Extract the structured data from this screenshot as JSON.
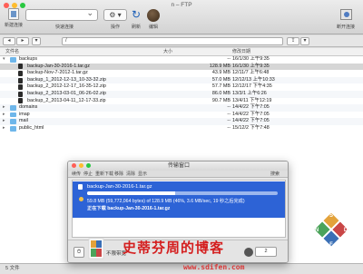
{
  "window": {
    "title": "n – FTP"
  },
  "toolbar": {
    "new_connection_label": "新建连接",
    "quick_connect_label": "快速连接",
    "action_label": "操作",
    "refresh_label": "刷新",
    "edit_label": "编辑",
    "disconnect_label": "断开连接"
  },
  "path": {
    "value": "/"
  },
  "columns": {
    "filename": "文件名",
    "size": "大小",
    "modified": "修改日期"
  },
  "files": [
    {
      "name": "backups",
      "kind": "folder",
      "expanded": true,
      "indent": 0,
      "size": "--",
      "date": "16/1/30 上午9:35"
    },
    {
      "name": "backup-Jan-30-2016-1.tar.gz",
      "kind": "file",
      "indent": 1,
      "size": "128.9 MB",
      "date": "16/1/30 上午9:35",
      "selected": true
    },
    {
      "name": "backup-Nov-7-2012-1.tar.gz",
      "kind": "file",
      "indent": 1,
      "size": "43.9 MB",
      "date": "12/11/7 上午6:48"
    },
    {
      "name": "backup_1_2012-12-13_10-33-32.zip",
      "kind": "file",
      "indent": 1,
      "size": "57.0 MB",
      "date": "12/12/13 上午10:33"
    },
    {
      "name": "backup_2_2012-12-17_16-35-12.zip",
      "kind": "file",
      "indent": 1,
      "size": "57.7 MB",
      "date": "12/12/17 下午4:35"
    },
    {
      "name": "backup_2_2013-03-01_06-26-02.zip",
      "kind": "file",
      "indent": 1,
      "size": "86.0 MB",
      "date": "13/3/1 上午6:26"
    },
    {
      "name": "backup_2_2013-04-11_12-17-33.zip",
      "kind": "file",
      "indent": 1,
      "size": "90.7 MB",
      "date": "13/4/11 下午12:19"
    },
    {
      "name": "domains",
      "kind": "folder",
      "indent": 0,
      "size": "--",
      "date": "14/4/22 下午7:05"
    },
    {
      "name": "imap",
      "kind": "folder",
      "indent": 0,
      "size": "--",
      "date": "14/4/22 下午7:05"
    },
    {
      "name": "mail",
      "kind": "folder",
      "indent": 0,
      "size": "--",
      "date": "14/4/22 下午7:05"
    },
    {
      "name": "public_html",
      "kind": "folder",
      "indent": 0,
      "size": "--",
      "date": "15/12/2 下午7:48"
    }
  ],
  "status": {
    "text": "5 文件"
  },
  "transfer": {
    "title": "传输窗口",
    "menu": [
      "续传",
      "停止",
      "重新下载",
      "移除",
      "清除",
      "显示"
    ],
    "search_label": "搜索",
    "item": {
      "name": "backup-Jan-30-2016-1.tar.gz",
      "progress": 0.46,
      "detail": "59.8 MB (59,772,064 bytes) of 128.9 MB (46%, 3.6 MB/sec, 19 秒之后完成)",
      "status": "正在下载 backup-Jan-30-2016-1.tar.gz"
    },
    "footer": {
      "bandwidth_label": "不限带宽",
      "connections": "2"
    }
  },
  "watermark": {
    "text": "史蒂芬周的博客",
    "url": "www.sdifen.com",
    "logo_letters": [
      "S",
      "D",
      "F",
      "N"
    ],
    "mini_letters": [
      "S",
      "D",
      "F",
      "N"
    ]
  },
  "colors": {
    "selection": "#2d63d6",
    "folder": "#6eb6ea",
    "watermark": "#d41e1e"
  }
}
